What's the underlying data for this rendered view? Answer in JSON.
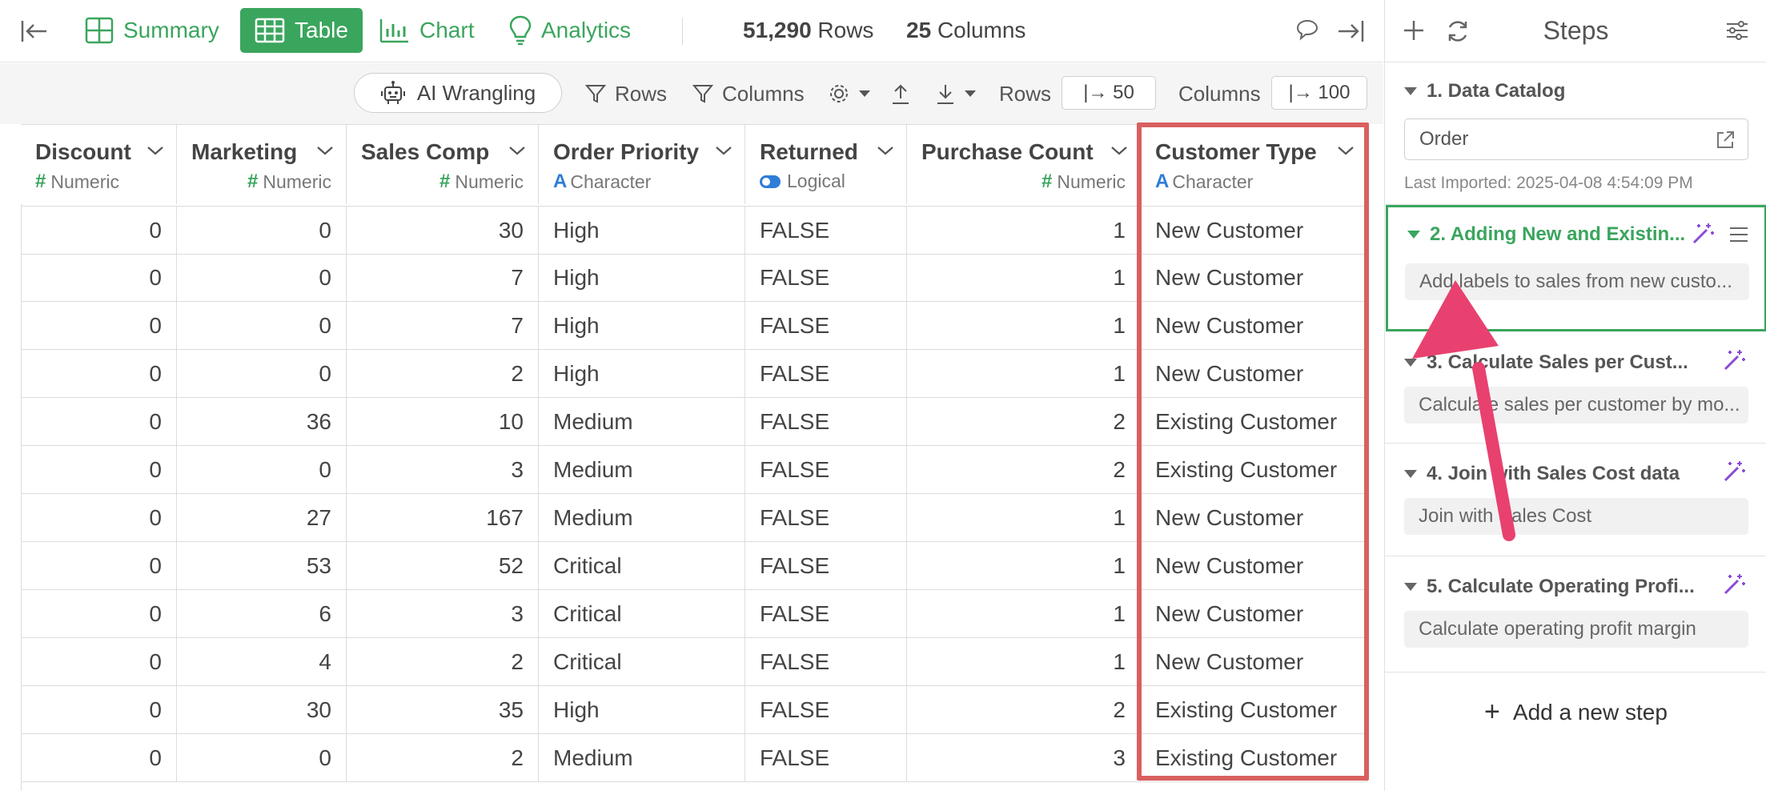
{
  "topbar": {
    "tabs": [
      {
        "label": "Summary",
        "icon": "grid-icon"
      },
      {
        "label": "Table",
        "icon": "table-icon",
        "active": true
      },
      {
        "label": "Chart",
        "icon": "bar-chart-icon"
      },
      {
        "label": "Analytics",
        "icon": "lightbulb-icon"
      }
    ],
    "rows_count": "51,290",
    "rows_label": "Rows",
    "cols_count": "25",
    "cols_label": "Columns"
  },
  "toolbar": {
    "ai_label": "AI Wrangling",
    "rows_filter": "Rows",
    "columns_filter": "Columns",
    "rows_label": "Rows",
    "rows_value": "|→ 50",
    "columns_label": "Columns",
    "columns_value": "|→ 100"
  },
  "table": {
    "columns": [
      {
        "name": "Discount",
        "type": "Numeric",
        "kind": "numeric"
      },
      {
        "name": "Marketing",
        "type": "Numeric",
        "kind": "numeric"
      },
      {
        "name": "Sales Comp",
        "type": "Numeric",
        "kind": "numeric"
      },
      {
        "name": "Order Priority",
        "type": "Character",
        "kind": "character"
      },
      {
        "name": "Returned",
        "type": "Logical",
        "kind": "logical"
      },
      {
        "name": "Purchase Count",
        "type": "Numeric",
        "kind": "numeric"
      },
      {
        "name": "Customer Type",
        "type": "Character",
        "kind": "character"
      }
    ],
    "rows": [
      [
        "0",
        "0",
        "30",
        "High",
        "FALSE",
        "1",
        "New Customer"
      ],
      [
        "0",
        "0",
        "7",
        "High",
        "FALSE",
        "1",
        "New Customer"
      ],
      [
        "0",
        "0",
        "7",
        "High",
        "FALSE",
        "1",
        "New Customer"
      ],
      [
        "0",
        "0",
        "2",
        "High",
        "FALSE",
        "1",
        "New Customer"
      ],
      [
        "0",
        "36",
        "10",
        "Medium",
        "FALSE",
        "2",
        "Existing Customer"
      ],
      [
        "0",
        "0",
        "3",
        "Medium",
        "FALSE",
        "2",
        "Existing Customer"
      ],
      [
        "0",
        "27",
        "167",
        "Medium",
        "FALSE",
        "1",
        "New Customer"
      ],
      [
        "0",
        "53",
        "52",
        "Critical",
        "FALSE",
        "1",
        "New Customer"
      ],
      [
        "0",
        "6",
        "3",
        "Critical",
        "FALSE",
        "1",
        "New Customer"
      ],
      [
        "0",
        "4",
        "2",
        "Critical",
        "FALSE",
        "1",
        "New Customer"
      ],
      [
        "0",
        "30",
        "35",
        "High",
        "FALSE",
        "2",
        "Existing Customer"
      ],
      [
        "0",
        "0",
        "2",
        "Medium",
        "FALSE",
        "3",
        "Existing Customer"
      ]
    ]
  },
  "steps_panel": {
    "title": "Steps",
    "catalog": {
      "title": "1. Data Catalog",
      "source": "Order",
      "last_imported": "Last Imported: 2025-04-08 4:54:09 PM"
    },
    "steps": [
      {
        "title": "2. Adding New and Existin...",
        "desc": "Add labels to sales from new custo...",
        "active": true
      },
      {
        "title": "3. Calculate Sales per Cust...",
        "desc": "Calculate sales per customer by mo..."
      },
      {
        "title": "4. Join with Sales Cost data",
        "desc": "Join with Sales Cost"
      },
      {
        "title": "5. Calculate Operating Profi...",
        "desc": "Calculate operating profit margin"
      }
    ],
    "add_step": "Add a new step"
  },
  "colors": {
    "accent_green": "#3aa55d",
    "highlight_red": "#d9605f",
    "arrow_pink": "#e8416f",
    "wand_purple": "#8a4bd6"
  }
}
